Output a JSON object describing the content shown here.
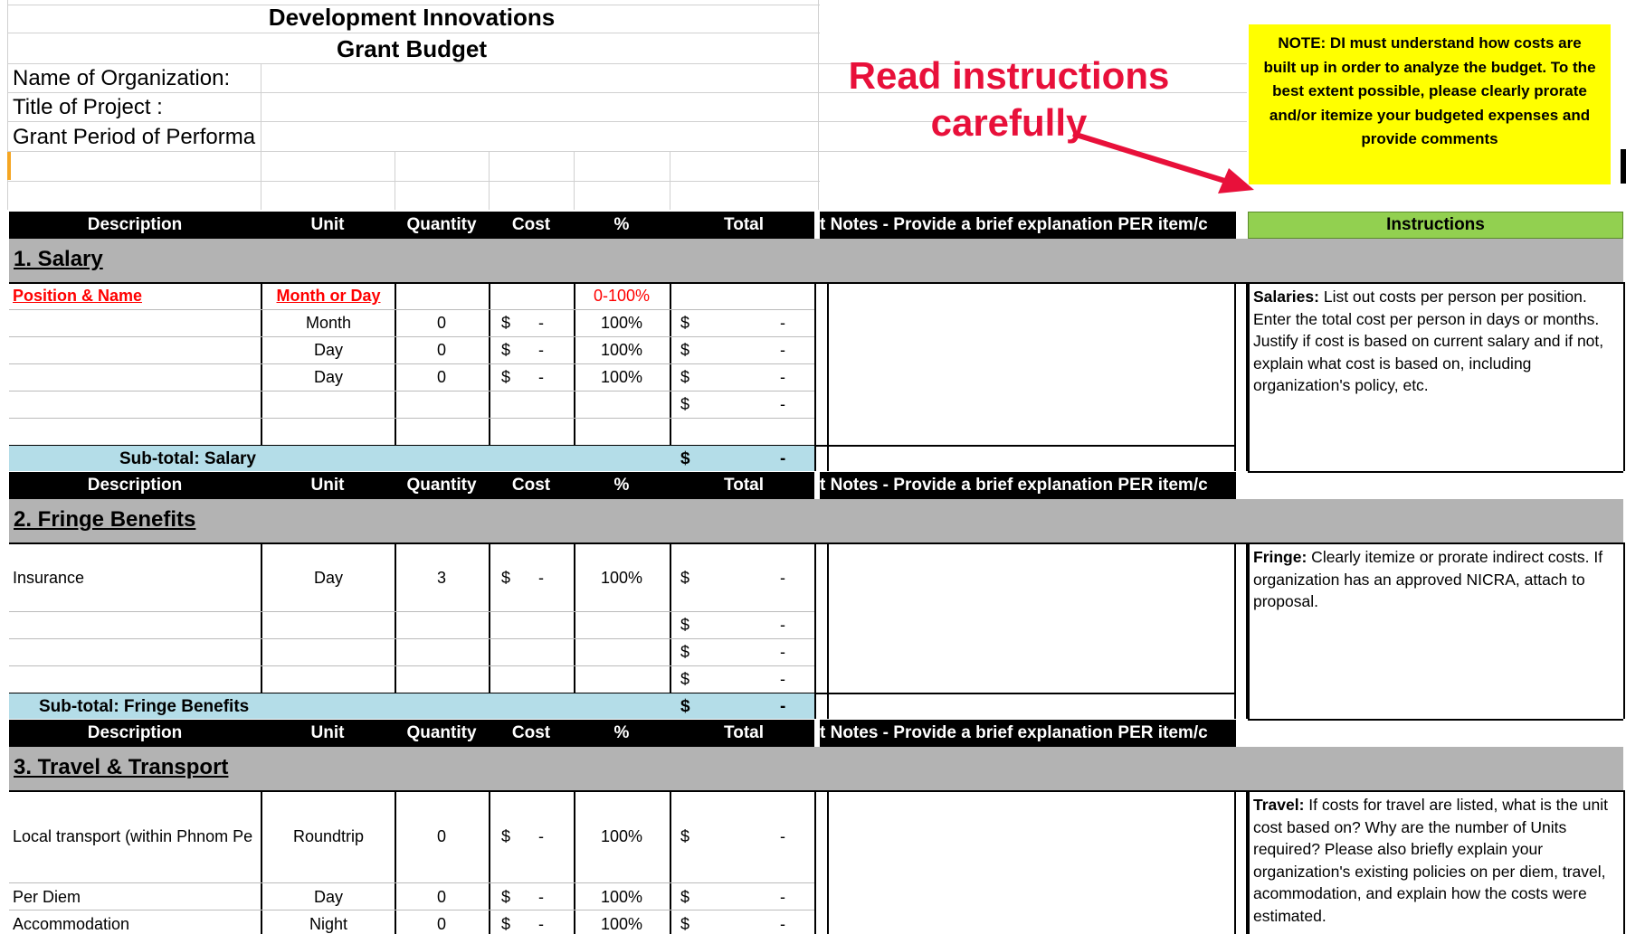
{
  "header": {
    "title_line1": "Development Innovations",
    "title_line2": "Grant Budget",
    "org_label": "Name of Organization:",
    "project_label": "Title of Project :",
    "period_label": "Grant Period of Performa"
  },
  "callout": {
    "read_line1": "Read instructions",
    "read_line2": "carefully",
    "note": "NOTE:  DI must understand  how costs are built up in order to analyze the budget.  To the best extent possible, please clearly prorate and/or itemize your budgeted  expenses  and  provide comments",
    "accent_color": "#e8103a",
    "note_color": "#ffff00"
  },
  "columns": {
    "description": "Description",
    "unit": "Unit",
    "quantity": "Quantity",
    "cost": "Cost",
    "percent": "%",
    "total": "Total",
    "notes": "t Notes  - Provide a brief explanation PER item/c",
    "instructions": "Instructions"
  },
  "salary": {
    "title": "1. Salary",
    "col_pos": "Position & Name ",
    "col_unit": "Month or Day",
    "col_pct": "0-100%",
    "rows": [
      {
        "unit": "Month",
        "qty": "0",
        "cost_sym": "$",
        "cost": "-",
        "pct": "100%",
        "tot_sym": "$",
        "tot": "-"
      },
      {
        "unit": "Day",
        "qty": "0",
        "cost_sym": "$",
        "cost": "-",
        "pct": "100%",
        "tot_sym": "$",
        "tot": "-"
      },
      {
        "unit": "Day",
        "qty": "0",
        "cost_sym": "$",
        "cost": "-",
        "pct": "100%",
        "tot_sym": "$",
        "tot": "-"
      },
      {
        "tot_sym": "$",
        "tot": "-"
      }
    ],
    "subtotal_label": "Sub-total: Salary",
    "subtotal_sym": "$",
    "subtotal_val": "-",
    "instr_bold": "Salaries:",
    "instr_text": "  List out costs per person per position.  Enter the total cost per person in days or months. Justify if cost is based on current salary and if not, explain what cost is based on, including organization's policy, etc."
  },
  "fringe": {
    "title": "2. Fringe Benefits",
    "rows": [
      {
        "desc": "Insurance",
        "unit": "Day",
        "qty": "3",
        "cost_sym": "$",
        "cost": "-",
        "pct": "100%",
        "tot_sym": "$",
        "tot": "-"
      },
      {
        "tot_sym": "$",
        "tot": "-"
      },
      {
        "tot_sym": "$",
        "tot": "-"
      },
      {
        "tot_sym": "$",
        "tot": "-"
      }
    ],
    "subtotal_label": "Sub-total: Fringe Benefits",
    "subtotal_sym": "$",
    "subtotal_val": "-",
    "instr_bold": "Fringe:",
    "instr_text": " Clearly itemize or prorate indirect costs.  If organization has an approved NICRA, attach to proposal."
  },
  "travel": {
    "title": "3. Travel & Transport",
    "rows": [
      {
        "desc": "Local transport (within Phnom Pe",
        "unit": "Roundtrip",
        "qty": "0",
        "cost_sym": "$",
        "cost": "-",
        "pct": "100%",
        "tot_sym": "$",
        "tot": "-"
      },
      {
        "desc": "Per Diem",
        "unit": "Day",
        "qty": "0",
        "cost_sym": "$",
        "cost": "-",
        "pct": "100%",
        "tot_sym": "$",
        "tot": "-"
      },
      {
        "desc": "Accommodation",
        "unit": "Night",
        "qty": "0",
        "cost_sym": "$",
        "cost": "-",
        "pct": "100%",
        "tot_sym": "$",
        "tot": "-"
      }
    ],
    "instr_bold": "Travel:",
    "instr_text": " If costs for travel are listed, what is the unit cost based on? Why are the number of Units required? Please also briefly explain your organization's existing policies on per diem, travel, acommodation, and explain how the costs were estimated."
  }
}
